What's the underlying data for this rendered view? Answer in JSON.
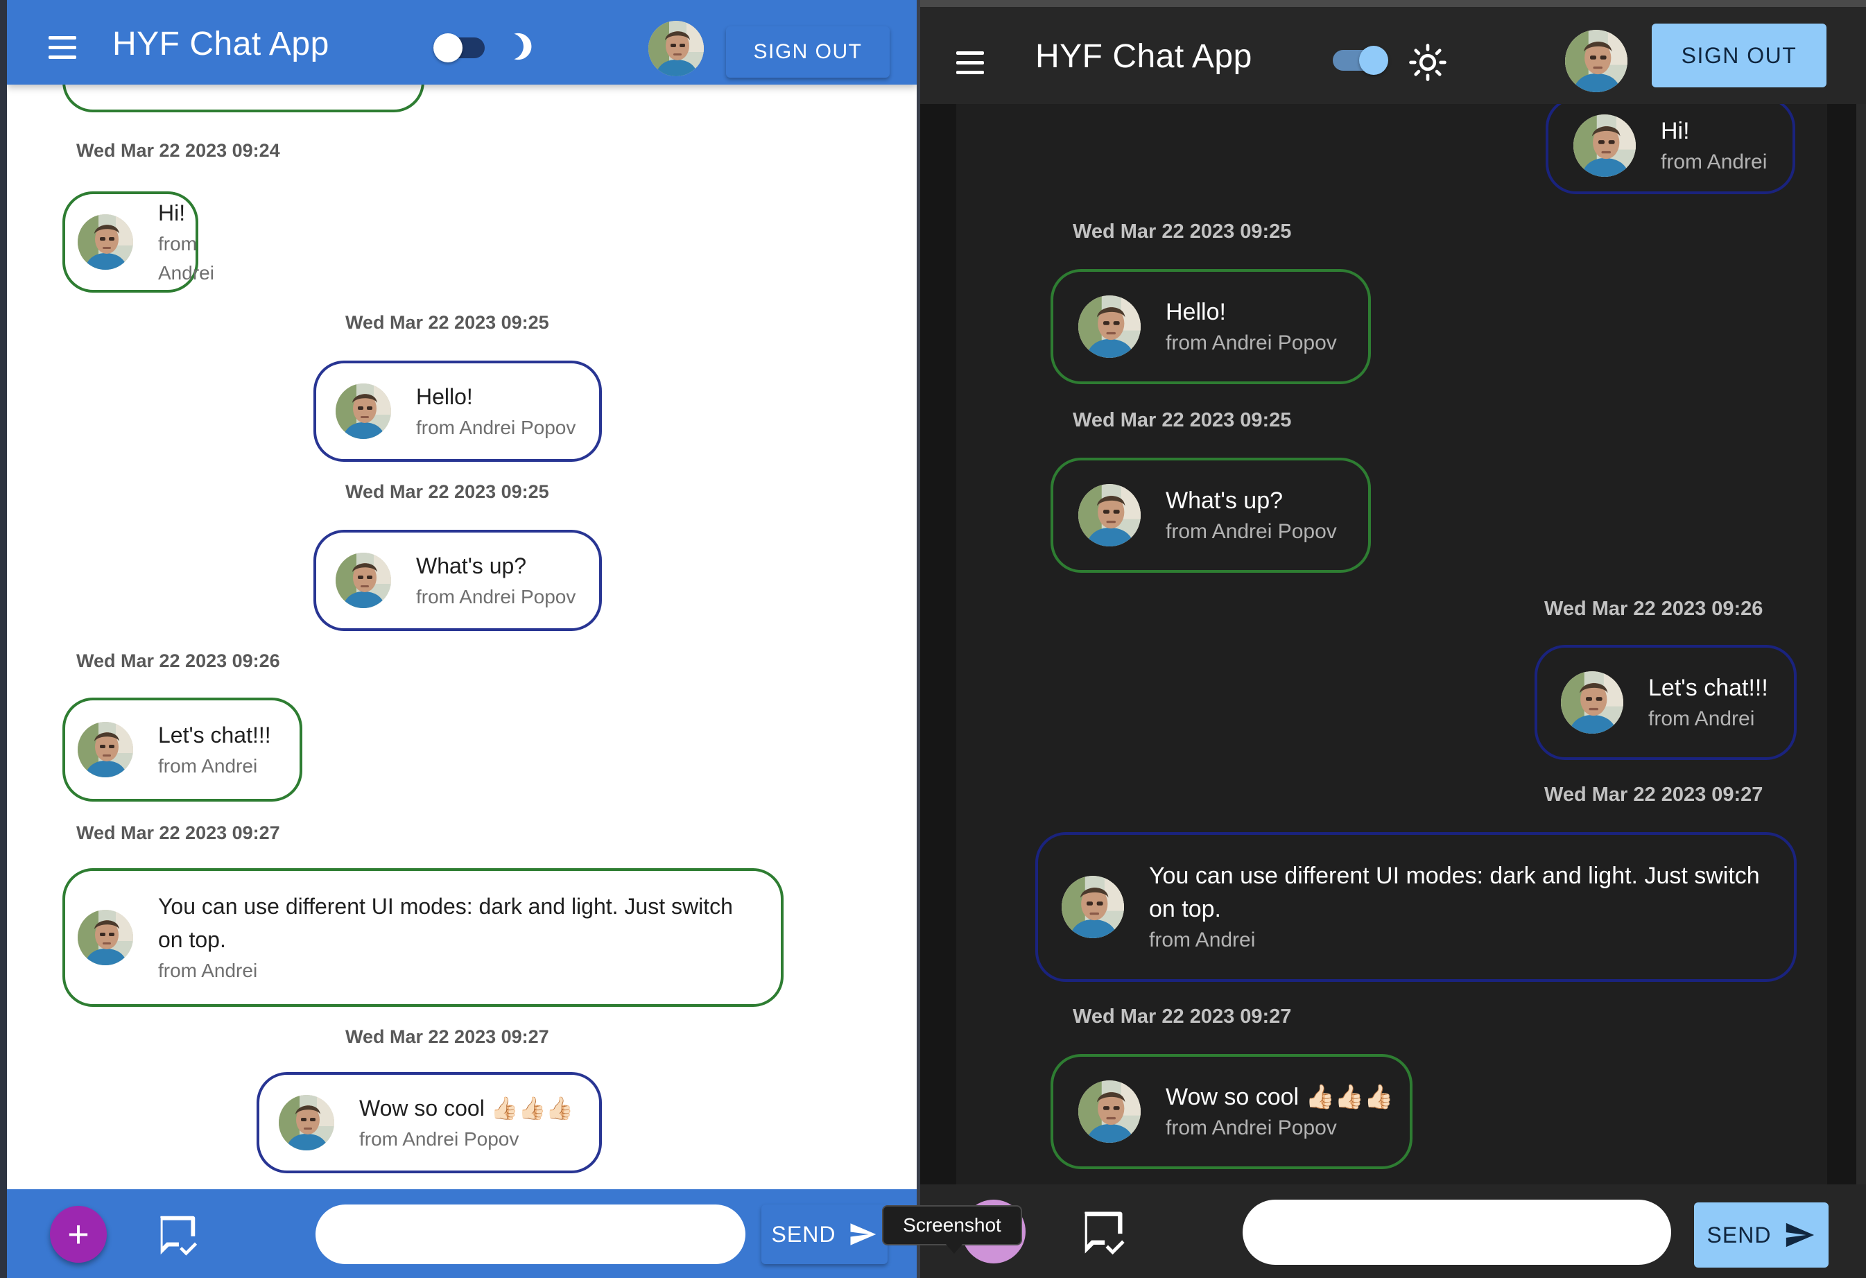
{
  "app": {
    "title": "HYF Chat App",
    "signout": "SIGN OUT",
    "send": "SEND",
    "fab": "+"
  },
  "input": {
    "placeholder": ""
  },
  "tooltip": "Screenshot",
  "light": {
    "messages": [
      {
        "kind": "in",
        "timestamp": "Wed Mar 22 2023 09:24",
        "text": "Hi!",
        "from": "from Andrei"
      },
      {
        "kind": "out",
        "timestamp": "Wed Mar 22 2023 09:25",
        "text": "Hello!",
        "from": "from Andrei Popov"
      },
      {
        "kind": "out",
        "timestamp": "Wed Mar 22 2023 09:25",
        "text": "What's up?",
        "from": "from Andrei Popov"
      },
      {
        "kind": "in",
        "timestamp": "Wed Mar 22 2023 09:26",
        "text": "Let's chat!!!",
        "from": "from Andrei"
      },
      {
        "kind": "in",
        "timestamp": "Wed Mar 22 2023 09:27",
        "text": "You can use different UI modes: dark and light. Just switch on top.",
        "from": "from Andrei"
      },
      {
        "kind": "out",
        "timestamp": "Wed Mar 22 2023 09:27",
        "text": "Wow so cool 👍🏻👍🏻👍🏻",
        "from": "from Andrei Popov"
      }
    ]
  },
  "dark": {
    "messages": [
      {
        "kind": "out",
        "timestamp": "",
        "text": "Hi!",
        "from": "from Andrei"
      },
      {
        "kind": "in",
        "timestamp": "Wed Mar 22 2023 09:25",
        "text": "Hello!",
        "from": "from Andrei Popov"
      },
      {
        "kind": "in",
        "timestamp": "Wed Mar 22 2023 09:25",
        "text": "What's up?",
        "from": "from Andrei Popov"
      },
      {
        "kind": "out",
        "timestamp": "Wed Mar 22 2023 09:26",
        "text": "Let's chat!!!",
        "from": "from Andrei"
      },
      {
        "kind": "out",
        "timestamp": "Wed Mar 22 2023 09:27",
        "text": "You can use different UI modes: dark and light. Just switch on top.",
        "from": "from Andrei"
      },
      {
        "kind": "in",
        "timestamp": "Wed Mar 22 2023 09:27",
        "text": "Wow so cool 👍🏻👍🏻👍🏻",
        "from": "from Andrei Popov"
      }
    ]
  },
  "colors": {
    "light_primary": "#3a78d1",
    "dark_primary": "#90caf9",
    "incoming_border": "#2e7d32",
    "outgoing_border": "#283593",
    "fab_light": "#9c27b0",
    "fab_dark": "#ce93d8"
  },
  "icons": {
    "menu": "menu-icon",
    "theme_light": "moon-icon",
    "theme_dark": "sun-icon",
    "chat_check": "chat-check-icon",
    "send": "send-icon"
  }
}
